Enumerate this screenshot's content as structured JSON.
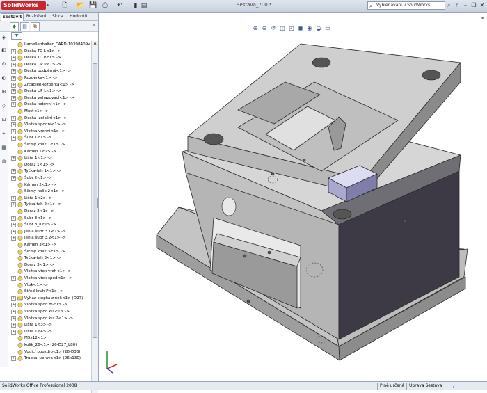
{
  "app": {
    "name": "SolidWorks",
    "document_title": "Sestava_700 *"
  },
  "search": {
    "placeholder": "Vyhledávání v SolidWorks"
  },
  "panel": {
    "tabs": [
      {
        "label": "Sestavit",
        "active": true
      },
      {
        "label": "Rozložení",
        "active": false
      },
      {
        "label": "Skica",
        "active": false
      },
      {
        "label": "Hodnotit",
        "active": false
      }
    ]
  },
  "tree": {
    "items": [
      {
        "label": "Lamellenhalter_CARD-10398409<1>",
        "expandable": false,
        "icon": "part-icon"
      },
      {
        "label": "Deska TC L<1> ->",
        "expandable": true,
        "icon": "part-icon"
      },
      {
        "label": "Deska TC P<1> ->",
        "expandable": true,
        "icon": "part-icon"
      },
      {
        "label": "Deska UP P<1> ->",
        "expandable": true,
        "icon": "part-icon"
      },
      {
        "label": "Deska podpěrná<1> ->",
        "expandable": true,
        "icon": "part-icon"
      },
      {
        "label": "Rozpěrka<1> ->",
        "expandable": true,
        "icon": "part-icon"
      },
      {
        "label": "ZrcadlenRozpěrka<1> ->",
        "expandable": true,
        "icon": "part-icon"
      },
      {
        "label": "Deska UP L<1> ->",
        "expandable": true,
        "icon": "part-icon"
      },
      {
        "label": "Deska vyhazovací<1> ->",
        "expandable": true,
        "icon": "part-icon"
      },
      {
        "label": "Deska kotevní<1> ->",
        "expandable": true,
        "icon": "part-icon"
      },
      {
        "label": "Most<1> ->",
        "expandable": false,
        "icon": "part-icon"
      },
      {
        "label": "Deska izolační<1> ->",
        "expandable": true,
        "icon": "part-icon"
      },
      {
        "label": "Vložka spodní<1> ->",
        "expandable": true,
        "icon": "part-icon"
      },
      {
        "label": "Vložka vrchní<1> ->",
        "expandable": true,
        "icon": "part-icon"
      },
      {
        "label": "Šubr 1<1> ->",
        "expandable": true,
        "icon": "part-icon"
      },
      {
        "label": "Šikmý kolík 1<1> ->",
        "expandable": false,
        "icon": "part-icon"
      },
      {
        "label": "Kámen 1<2> ->",
        "expandable": false,
        "icon": "part-icon"
      },
      {
        "label": "Lišta 1<1> ->",
        "expandable": true,
        "icon": "part-icon"
      },
      {
        "label": "Doraz 1<1> ->",
        "expandable": false,
        "icon": "part-icon"
      },
      {
        "label": "Tyčka-tah 1<1> ->",
        "expandable": true,
        "icon": "part-icon"
      },
      {
        "label": "Šubr 2<1> ->",
        "expandable": true,
        "icon": "part-icon"
      },
      {
        "label": "Kámen 2<1> ->",
        "expandable": false,
        "icon": "part-icon"
      },
      {
        "label": "Šikmý kolík 2<1> ->",
        "expandable": false,
        "icon": "part-icon"
      },
      {
        "label": "Lišta 1<2> ->",
        "expandable": true,
        "icon": "part-icon"
      },
      {
        "label": "Tyčka-tah 2<1> ->",
        "expandable": true,
        "icon": "part-icon"
      },
      {
        "label": "Doraz 2<1> ->",
        "expandable": false,
        "icon": "part-icon"
      },
      {
        "label": "Šubr 3<1> ->",
        "expandable": true,
        "icon": "part-icon"
      },
      {
        "label": "Šubr 3_II<1> ->",
        "expandable": true,
        "icon": "part-icon"
      },
      {
        "label": "Jehla šubr 3.1<1> ->",
        "expandable": true,
        "icon": "part-icon"
      },
      {
        "label": "Jehla šubr 3.2<1> ->",
        "expandable": true,
        "icon": "part-icon"
      },
      {
        "label": "Kámen 3<1> ->",
        "expandable": false,
        "icon": "part-icon"
      },
      {
        "label": "Šikmý kolík 3<1> ->",
        "expandable": false,
        "icon": "part-icon"
      },
      {
        "label": "Tyčka-tah 3<1> ->",
        "expandable": false,
        "icon": "part-icon"
      },
      {
        "label": "Doraz 3<1> ->",
        "expandable": false,
        "icon": "part-icon"
      },
      {
        "label": "Vložka vtok vrch<1> ->",
        "expandable": false,
        "icon": "part-icon"
      },
      {
        "label": "Vložka vtok spod<1> ->",
        "expandable": true,
        "icon": "part-icon"
      },
      {
        "label": "Vtok<1> ->",
        "expandable": false,
        "icon": "part-icon"
      },
      {
        "label": "Střed kruh P<1> ->",
        "expandable": false,
        "icon": "part-icon"
      },
      {
        "label": "Vyhaz stopka zinek<1> (D27)",
        "expandable": true,
        "icon": "subassembly-icon"
      },
      {
        "label": "Vložka spod m<1> ->",
        "expandable": true,
        "icon": "part-icon"
      },
      {
        "label": "Vložka spod kul<1> ->",
        "expandable": true,
        "icon": "part-icon"
      },
      {
        "label": "Vložka spod kul 2<1> ->",
        "expandable": true,
        "icon": "part-icon"
      },
      {
        "label": "Lišta 1<3> ->",
        "expandable": true,
        "icon": "part-icon"
      },
      {
        "label": "Lišta 1<4> ->",
        "expandable": true,
        "icon": "part-icon"
      },
      {
        "label": "M5x12<1>",
        "expandable": false,
        "icon": "part-icon"
      },
      {
        "label": "kolík_26<1> (26-D27_L80)",
        "expandable": false,
        "icon": "part-icon"
      },
      {
        "label": "Vodicí pouzdro<1> (26-D36)",
        "expandable": false,
        "icon": "part-icon"
      },
      {
        "label": "Trubka_uprava<1> (26x130)",
        "expandable": true,
        "icon": "part-icon"
      }
    ]
  },
  "status": {
    "left": "SolidWorks Office Professional 2008",
    "mode": "Plně určená",
    "edit": "Úprava Sestava"
  },
  "colors": {
    "accent": "#c9252c",
    "part_fill": "#c8c8c8",
    "part_edge": "#2a2a2a"
  }
}
